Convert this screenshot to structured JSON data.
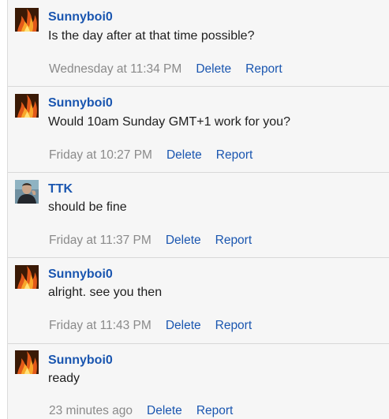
{
  "messages": [
    {
      "author": "Sunnyboi0",
      "avatar": "fire-avatar",
      "text": "Is the day after at that time possible?",
      "time": "Wednesday at 11:34 PM",
      "delete_label": "Delete",
      "report_label": "Report"
    },
    {
      "author": "Sunnyboi0",
      "avatar": "fire-avatar",
      "text": "Would 10am Sunday GMT+1 work for you?",
      "time": "Friday at 10:27 PM",
      "delete_label": "Delete",
      "report_label": "Report"
    },
    {
      "author": "TTK",
      "avatar": "person-avatar",
      "text": "should be fine",
      "time": "Friday at 11:37 PM",
      "delete_label": "Delete",
      "report_label": "Report"
    },
    {
      "author": "Sunnyboi0",
      "avatar": "fire-avatar",
      "text": "alright. see you then",
      "time": "Friday at 11:43 PM",
      "delete_label": "Delete",
      "report_label": "Report"
    },
    {
      "author": "Sunnyboi0",
      "avatar": "fire-avatar",
      "text": "ready",
      "time": "23 minutes ago",
      "delete_label": "Delete",
      "report_label": "Report"
    }
  ],
  "colors": {
    "link": "#1a56b0",
    "time": "#8a8a8a",
    "background": "#f6f6f6"
  }
}
